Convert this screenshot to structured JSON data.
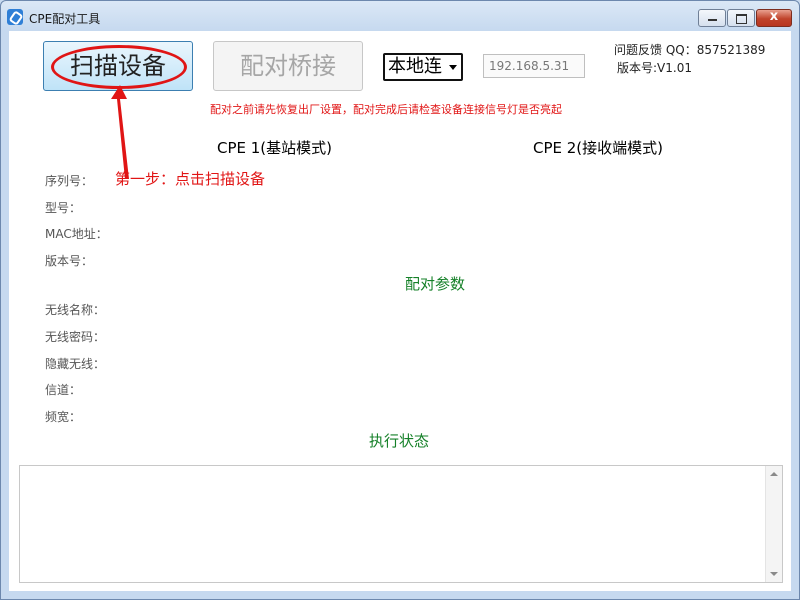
{
  "window": {
    "title": "CPE配对工具",
    "close_glyph": "x"
  },
  "toolbar": {
    "scan_label": "扫描设备",
    "pair_label": "配对桥接",
    "connection_selected": "本地连",
    "ip_value": "192.168.5.31",
    "feedback": "问题反馈 QQ：857521389",
    "version": "版本号:V1.01"
  },
  "warning": "配对之前请先恢复出厂设置，配对完成后请检查设备连接信号灯是否亮起",
  "annotation": {
    "step": "第一步：点击扫描设备"
  },
  "cpe1_header": "CPE 1(基站模式)",
  "cpe2_header": "CPE 2(接收端模式)",
  "device_fields": {
    "serial": "序列号：",
    "model": "型号：",
    "mac": "MAC地址：",
    "version": "版本号："
  },
  "pair_section_title": "配对参数",
  "pair_fields": {
    "ssid": "无线名称：",
    "password": "无线密码：",
    "hidden": "隐藏无线：",
    "channel": "信道：",
    "bandwidth": "频宽："
  },
  "status_section_title": "执行状态",
  "colors": {
    "accent_red": "#e11515",
    "section_green": "#158028"
  }
}
